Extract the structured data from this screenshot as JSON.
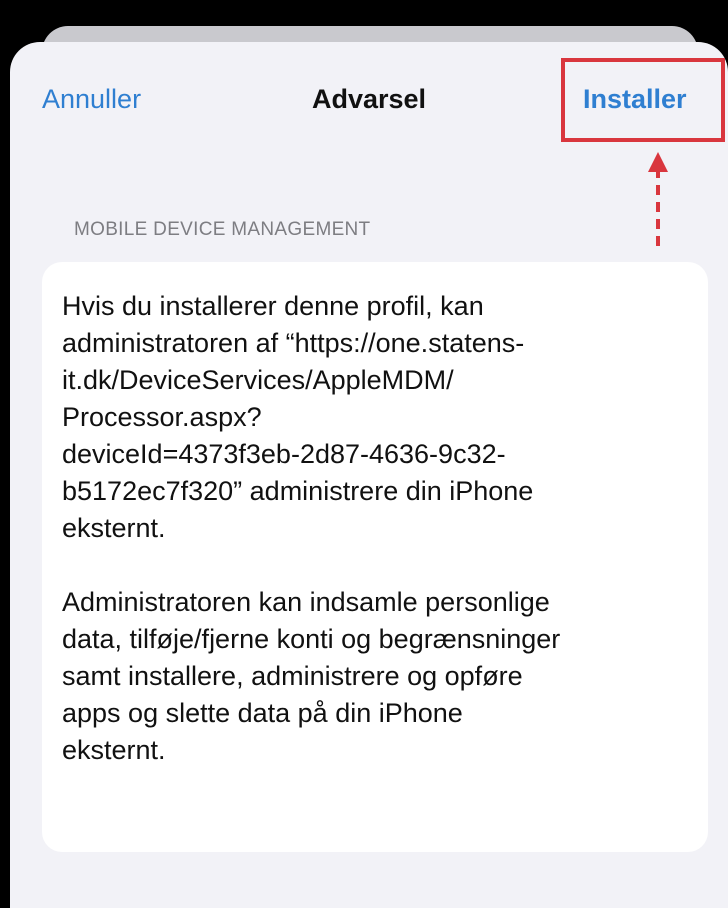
{
  "nav": {
    "cancel_label": "Annuller",
    "title": "Advarsel",
    "install_label": "Installer"
  },
  "section": {
    "header": "MOBILE DEVICE MANAGEMENT"
  },
  "warning": {
    "paragraph_1": "Hvis du installerer denne profil, kan\nadministratoren af “https://one.statens-\nit.dk/DeviceServices/AppleMDM/\nProcessor.aspx?\ndeviceId=4373f3eb-2d87-4636-9c32-\nb5172ec7f320” administrere din iPhone\neksternt.",
    "paragraph_2": "Administratoren kan indsamle personlige\ndata, tilføje/fjerne konti og begrænsninger\nsamt installere, administrere og opføre\napps og slette data på din iPhone\neksternt."
  },
  "colors": {
    "accent": "#2f7fd1",
    "annotation": "#d9363e",
    "background": "#f2f2f7",
    "card": "#ffffff",
    "secondary_text": "#7d7d82"
  },
  "annotation": {
    "icon": "dashed-up-arrow-icon"
  }
}
